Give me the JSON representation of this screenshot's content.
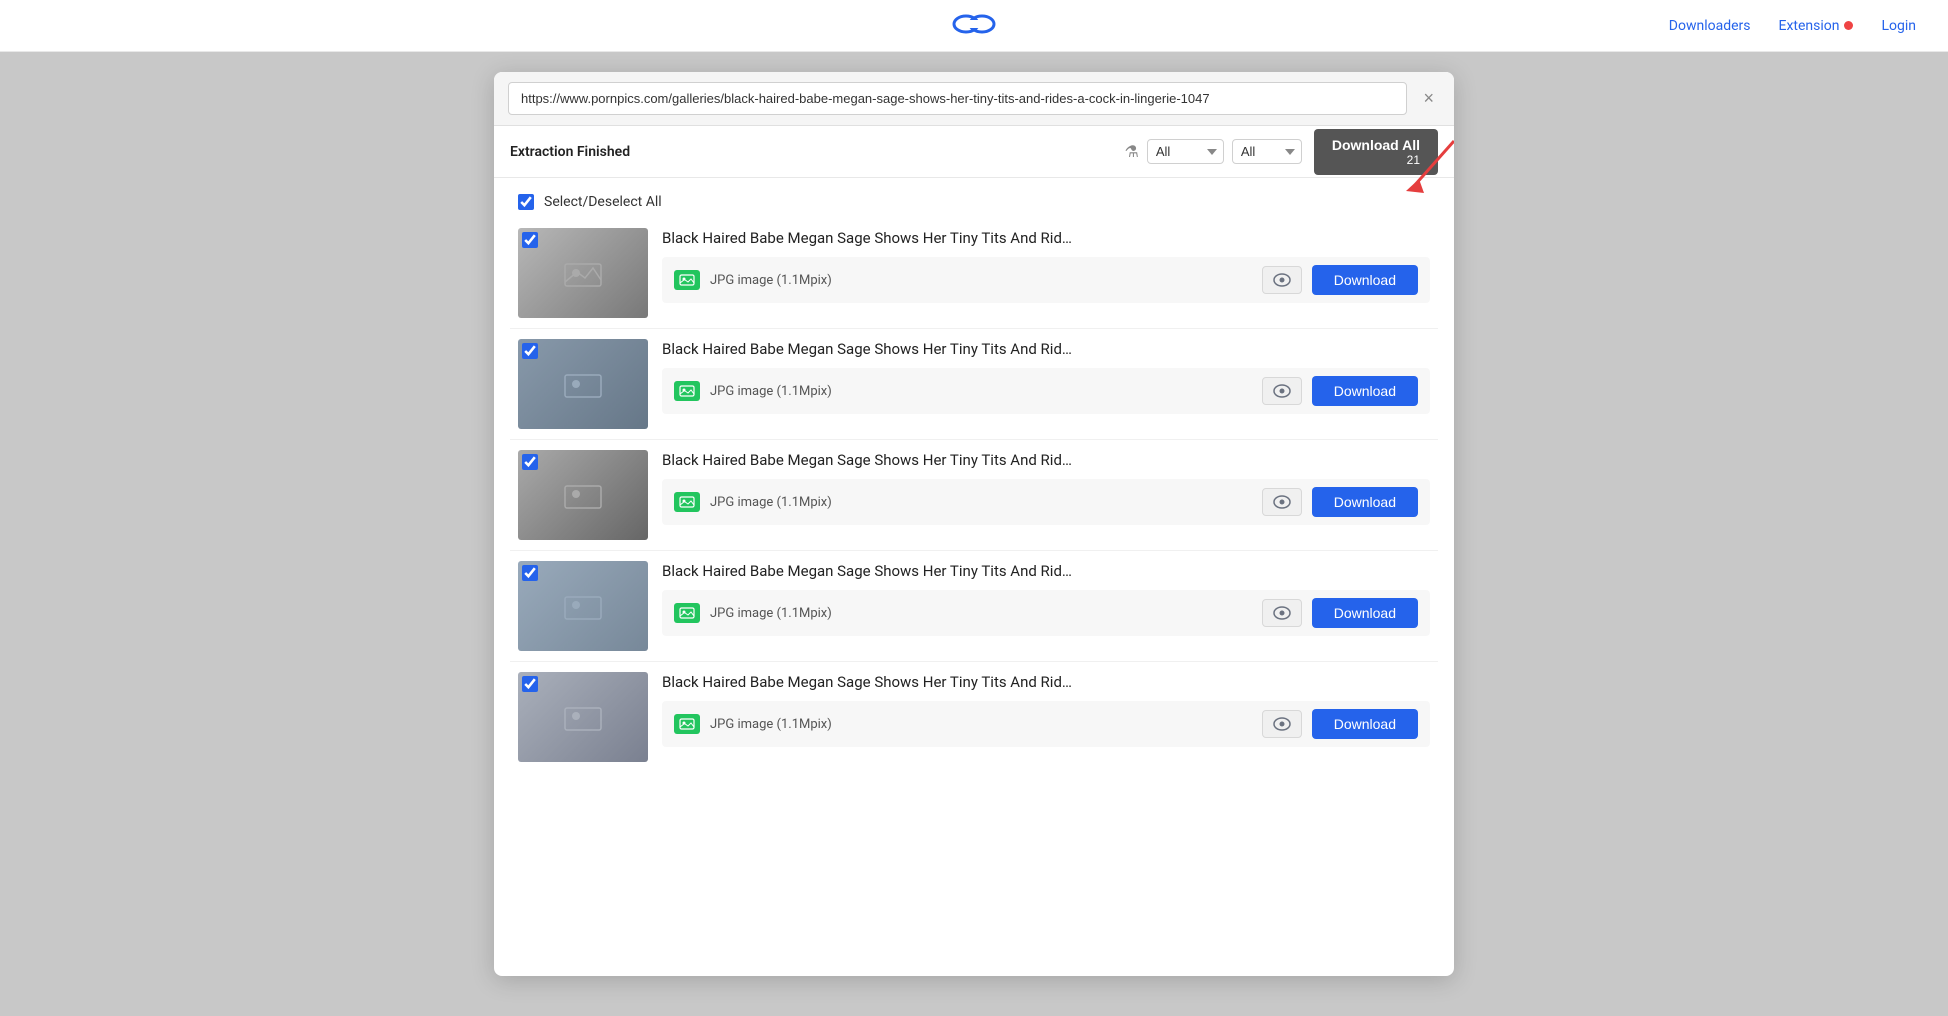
{
  "nav": {
    "logo_label": "Link logo",
    "downloaders_label": "Downloaders",
    "extension_label": "Extension",
    "login_label": "Login"
  },
  "url_bar": {
    "url_value": "https://www.pornpics.com/galleries/black-haired-babe-megan-sage-shows-her-tiny-tits-and-rides-a-cock-in-lingerie-1047",
    "close_label": "×"
  },
  "toolbar": {
    "status": "Extraction Finished",
    "filter1_label": "▾ All",
    "filter2_label": "▾ All",
    "download_all_label": "Download All",
    "count": "21"
  },
  "select_all": {
    "label": "Select/Deselect All"
  },
  "items": [
    {
      "title": "Black Haired Babe Megan Sage Shows Her Tiny Tits And Rid…",
      "type": "JPG image (1.1Mpix)",
      "download_label": "Download"
    },
    {
      "title": "Black Haired Babe Megan Sage Shows Her Tiny Tits And Rid…",
      "type": "JPG image (1.1Mpix)",
      "download_label": "Download"
    },
    {
      "title": "Black Haired Babe Megan Sage Shows Her Tiny Tits And Rid…",
      "type": "JPG image (1.1Mpix)",
      "download_label": "Download"
    },
    {
      "title": "Black Haired Babe Megan Sage Shows Her Tiny Tits And Rid…",
      "type": "JPG image (1.1Mpix)",
      "download_label": "Download"
    },
    {
      "title": "Black Haired Babe Megan Sage Shows Her Tiny Tits And Rid…",
      "type": "JPG image (1.1Mpix)",
      "download_label": "Download"
    }
  ],
  "colors": {
    "accent": "#2563eb",
    "download_all_bg": "#555555",
    "green_icon": "#22c55e"
  }
}
